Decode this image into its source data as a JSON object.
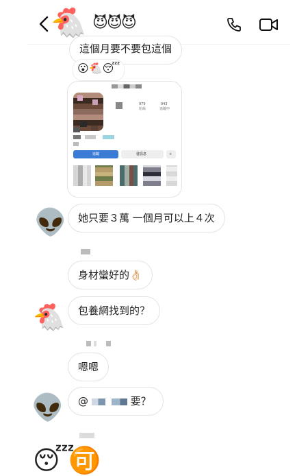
{
  "header": {
    "contact_name": "😈😈😈",
    "avatar_emoji": "🐔"
  },
  "messages": [
    {
      "text": "這個月要不要包這個"
    },
    {
      "reactions": "😮🐔😴"
    },
    {
      "text": "她只要３萬 一個月可以上４次",
      "avatar": "👽"
    },
    {
      "text": "身材蠻好的👌🏻"
    },
    {
      "text": "包養網找到的？",
      "avatar": "🐔"
    },
    {
      "text": "嗯嗯"
    },
    {
      "text_prefix": "@",
      "text_suffix": "要？",
      "avatar": "👽"
    },
    {
      "emojis": [
        "😴",
        "🉑"
      ]
    }
  ],
  "post_card": {
    "posts_count": "979",
    "posts_label": "粉絲",
    "following_count": "943",
    "following_label": "追蹤中",
    "follow_label": "追蹤",
    "message_label": "發訊息",
    "add_icon": "person-add"
  },
  "colors": {
    "bubble_border": "#e3e3e3",
    "follow_button": "#3a7bd5"
  }
}
